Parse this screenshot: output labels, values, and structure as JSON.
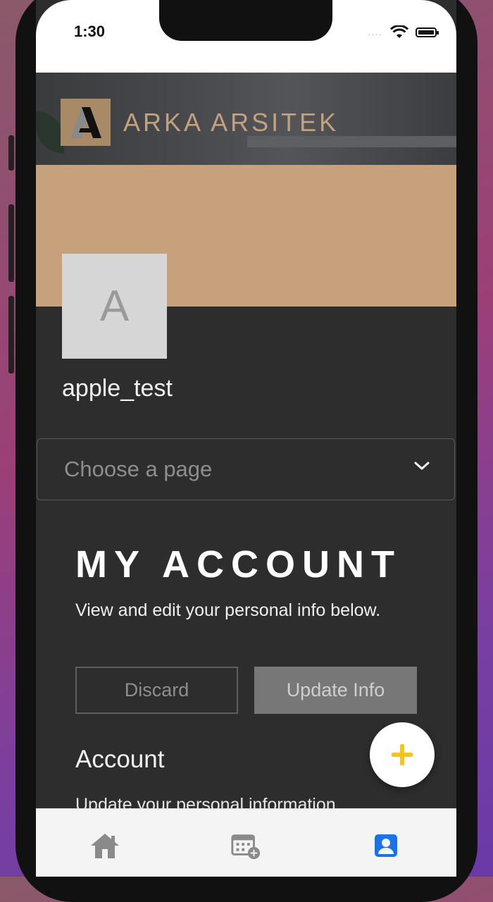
{
  "status_bar": {
    "time": "1:30",
    "signal": "...."
  },
  "brand": {
    "logo_text": "ARKA ARSITEK",
    "logo_small": "ARKA ARSITEK"
  },
  "profile": {
    "avatar_letter": "A",
    "username": "apple_test"
  },
  "page_select": {
    "placeholder": "Choose a page"
  },
  "account": {
    "heading": "MY ACCOUNT",
    "description": "View and edit your personal info below.",
    "discard_label": "Discard",
    "update_label": "Update Info",
    "section_title": "Account",
    "section_subtitle": "Update your personal information"
  },
  "fab": {
    "symbol": "+"
  },
  "tabbar": {
    "items": [
      {
        "name": "home",
        "icon": "home-icon",
        "active": false
      },
      {
        "name": "calendar",
        "icon": "calendar-add-icon",
        "active": false
      },
      {
        "name": "profile",
        "icon": "profile-icon",
        "active": true
      }
    ]
  },
  "colors": {
    "tan": "#c6a17b",
    "gold_text": "#c2a27e",
    "dark_bg": "#2d2d2d",
    "fab_plus": "#f5c518",
    "active_tab": "#1a73e8"
  }
}
